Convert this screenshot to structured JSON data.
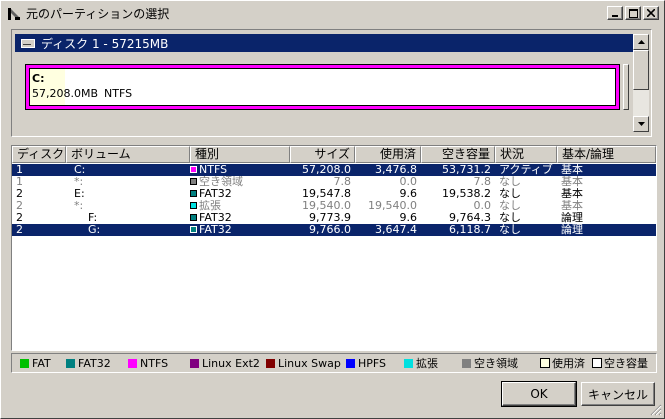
{
  "window": {
    "title": "元のパーティションの選択"
  },
  "disk": {
    "header": "ディスク 1 - 57215MB",
    "partition": {
      "label": "C:",
      "size": "57,208.0MB",
      "fs": "NTFS",
      "color": "#ff00ff",
      "used_fraction": 0.06
    }
  },
  "columns": [
    "ディスク",
    "ボリューム",
    "種別",
    "サイズ",
    "使用済",
    "空き容量",
    "状況",
    "基本/論理"
  ],
  "rows": [
    {
      "disk": "1",
      "volume": "C:",
      "type": "NTFS",
      "color": "#ff00ff",
      "size": "57,208.0",
      "used": "3,476.8",
      "free": "53,731.2",
      "status": "アクティブ",
      "kind": "基本",
      "selected": true,
      "dim": false
    },
    {
      "disk": "1",
      "volume": "*:",
      "type": "空き領域",
      "color": "#808080",
      "size": "7.8",
      "used": "0.0",
      "free": "7.8",
      "status": "なし",
      "kind": "基本",
      "selected": false,
      "dim": true
    },
    {
      "disk": "2",
      "volume": "E:",
      "type": "FAT32",
      "color": "#008080",
      "size": "19,547.8",
      "used": "9.6",
      "free": "19,538.2",
      "status": "なし",
      "kind": "基本",
      "selected": false,
      "dim": false
    },
    {
      "disk": "2",
      "volume": "*:",
      "type": "拡張",
      "color": "#00e0e0",
      "size": "19,540.0",
      "used": "19,540.0",
      "free": "0.0",
      "status": "なし",
      "kind": "基本",
      "selected": false,
      "dim": true
    },
    {
      "disk": "2",
      "volume": "F:",
      "type": "FAT32",
      "color": "#008080",
      "size": "9,773.9",
      "used": "9.6",
      "free": "9,764.3",
      "status": "なし",
      "kind": "論理",
      "selected": false,
      "dim": false,
      "indent": true
    },
    {
      "disk": "2",
      "volume": "G:",
      "type": "FAT32",
      "color": "#008080",
      "size": "9,766.0",
      "used": "3,647.4",
      "free": "6,118.7",
      "status": "なし",
      "kind": "論理",
      "selected": true,
      "dim": false,
      "indent": true
    }
  ],
  "legend": [
    {
      "label": "FAT",
      "color": "#00c000"
    },
    {
      "label": "FAT32",
      "color": "#008080"
    },
    {
      "label": "NTFS",
      "color": "#ff00ff"
    },
    {
      "label": "Linux Ext2",
      "color": "#800080"
    },
    {
      "label": "Linux Swap",
      "color": "#800000"
    },
    {
      "label": "HPFS",
      "color": "#0000ff"
    },
    {
      "label": "拡張",
      "color": "#00e0e0"
    },
    {
      "label": "空き領域",
      "color": "#808080"
    }
  ],
  "legend_boxes": [
    {
      "label": "使用済",
      "color": "#ffffe0"
    },
    {
      "label": "空き容量",
      "color": "#ffffff"
    }
  ],
  "buttons": {
    "ok": "OK",
    "cancel": "キャンセル"
  }
}
